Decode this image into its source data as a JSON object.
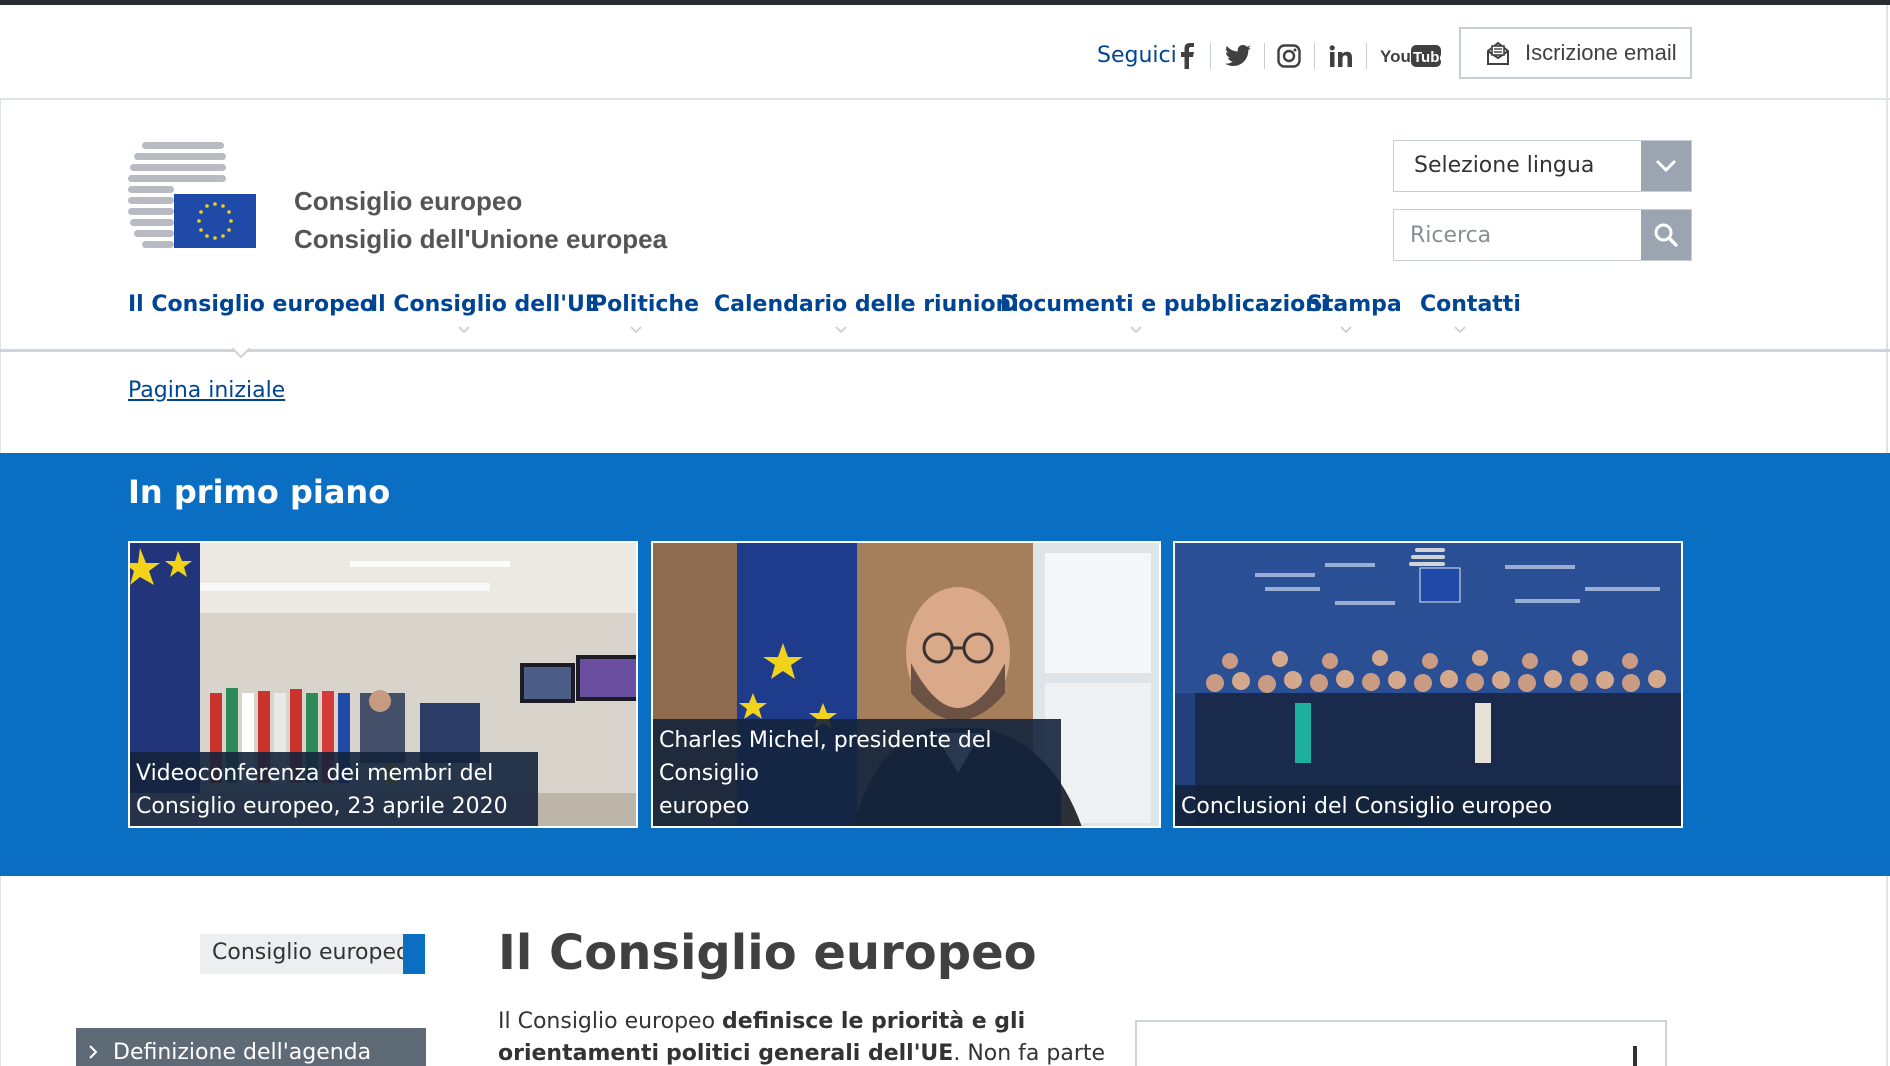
{
  "utility": {
    "follow_label": "Seguici",
    "social_icons": [
      "facebook-icon",
      "twitter-icon",
      "instagram-icon",
      "linkedin-icon",
      "youtube-icon"
    ],
    "youtube_text": "YouTube",
    "email_label": "Iscrizione email"
  },
  "header": {
    "org_name_1": "Consiglio europeo",
    "org_name_2": "Consiglio dell'Unione europea",
    "language_label": "Selezione lingua",
    "search_placeholder": "Ricerca"
  },
  "nav": {
    "items": [
      {
        "label": "Il Consiglio europeo"
      },
      {
        "label": "Il Consiglio dell'UE"
      },
      {
        "label": "Politiche"
      },
      {
        "label": "Calendario delle riunioni"
      },
      {
        "label": "Documenti e pubblicazioni"
      },
      {
        "label": "Stampa"
      },
      {
        "label": "Contatti"
      }
    ]
  },
  "breadcrumb": {
    "home": "Pagina iniziale"
  },
  "featured": {
    "title": "In primo piano",
    "cards": [
      {
        "caption_1": "Videoconferenza dei membri del",
        "caption_2": "Consiglio europeo, 23 aprile 2020"
      },
      {
        "caption_1": "Charles Michel, presidente del Consiglio",
        "caption_2": "europeo"
      },
      {
        "caption_1": "Conclusioni del Consiglio europeo"
      }
    ]
  },
  "sidebar": {
    "section_label": "Consiglio europeo",
    "items": [
      {
        "label": "Definizione dell'agenda"
      }
    ]
  },
  "main": {
    "title": "Il Consiglio europeo",
    "intro_1": "Il Consiglio europeo ",
    "intro_bold_1": "definisce le priorità e gli orientamenti",
    "intro_bold_2": "politici generali dell'UE",
    "intro_2": ". Non fa parte dei legislatori dell'UE e"
  },
  "colors": {
    "brand_blue": "#004494",
    "band_blue": "#0a6fc2",
    "eu_flag_blue": "#1f4aa8",
    "eu_star_yellow": "#f2d31b"
  }
}
